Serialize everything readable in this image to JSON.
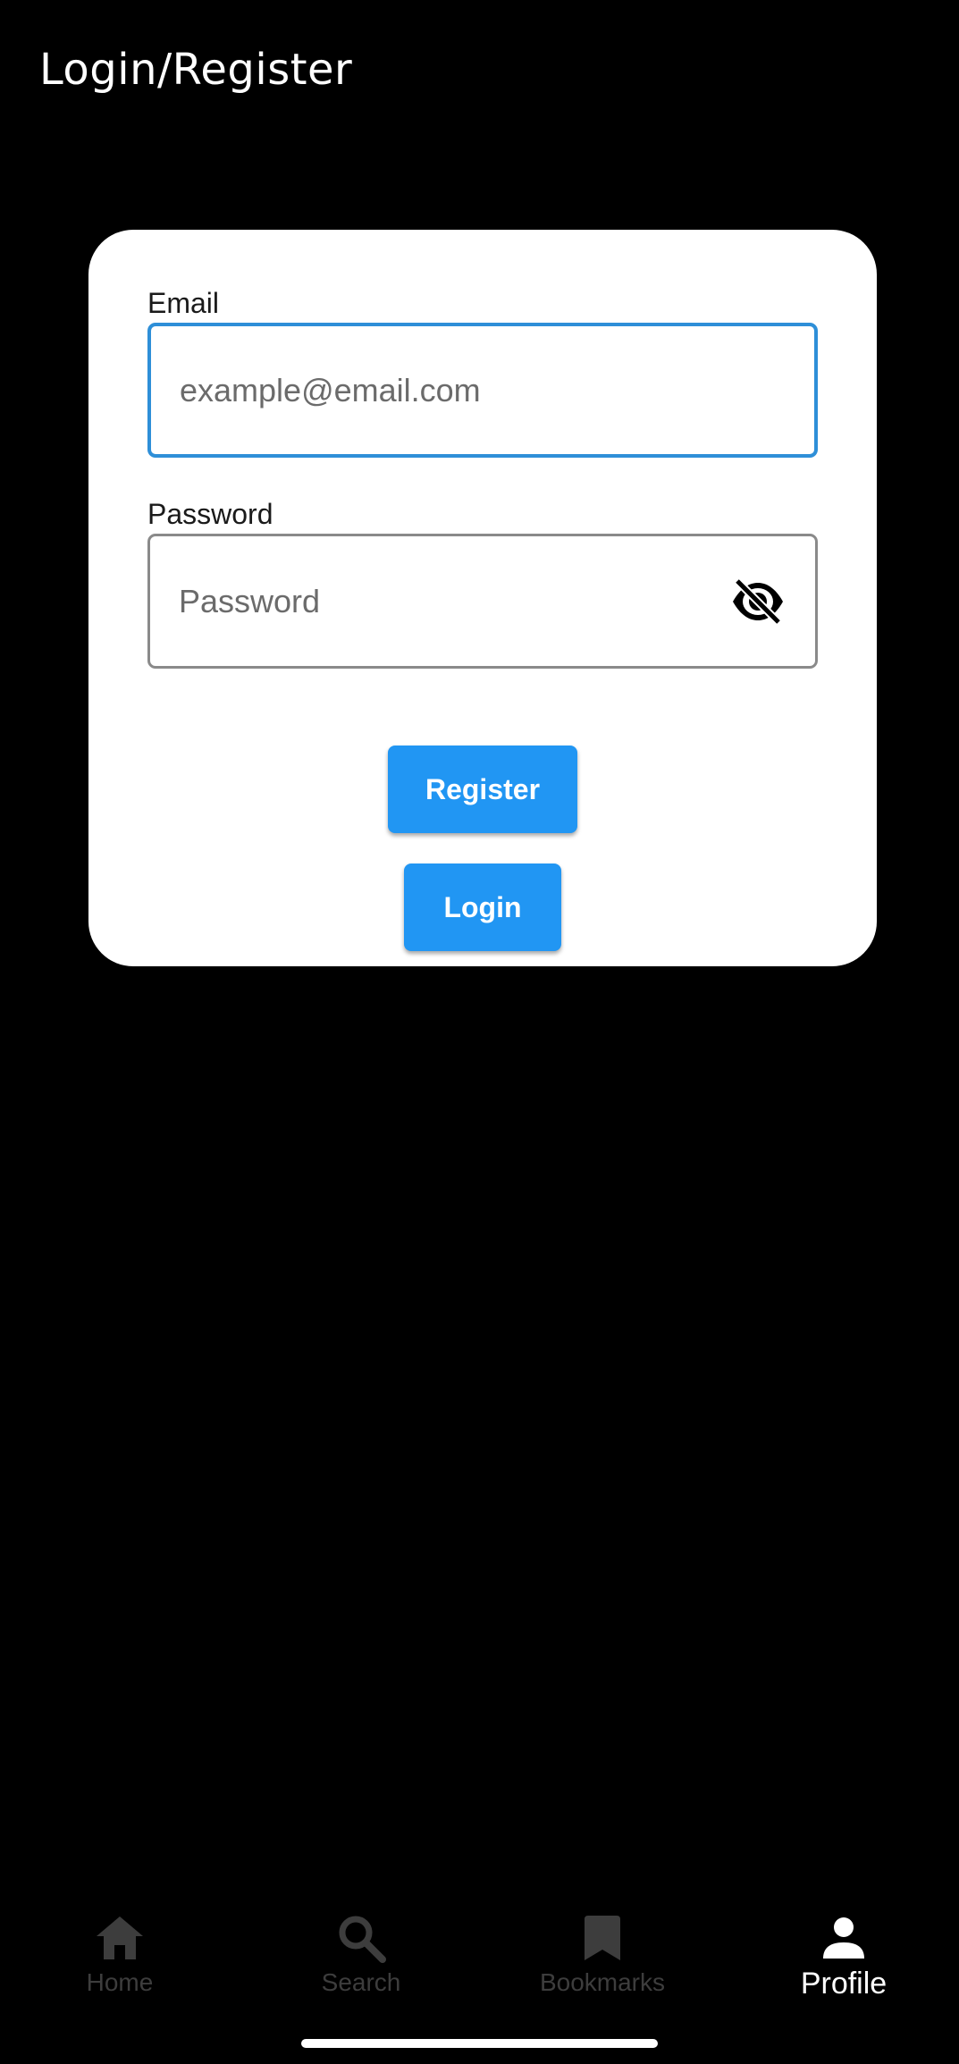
{
  "header": {
    "title": "Login/Register"
  },
  "form": {
    "email_label": "Email",
    "email_value": "",
    "email_placeholder": "example@email.com",
    "password_label": "Password",
    "password_value": "",
    "password_placeholder": "Password",
    "password_visibility_icon": "eye-off-icon",
    "register_label": "Register",
    "login_label": "Login"
  },
  "bottom_nav": {
    "items": [
      {
        "label": "Home",
        "icon": "home-icon",
        "active": false
      },
      {
        "label": "Search",
        "icon": "search-icon",
        "active": false
      },
      {
        "label": "Bookmarks",
        "icon": "bookmark-icon",
        "active": false
      },
      {
        "label": "Profile",
        "icon": "person-icon",
        "active": true
      }
    ]
  },
  "colors": {
    "background": "#000000",
    "card": "#ffffff",
    "accent": "#2196f3",
    "focus_border": "#2e8fd8",
    "inactive_nav": "#3d3d3d",
    "active_nav": "#ffffff"
  }
}
